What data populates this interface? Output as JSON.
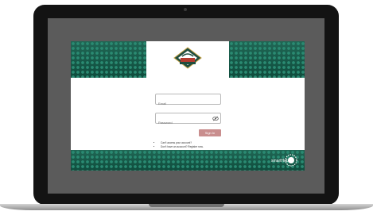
{
  "brand": {
    "logo_alt": "Sports Electric Cooperative",
    "smart_logo_text": "smartHub"
  },
  "form": {
    "email_placeholder": "Email",
    "password_placeholder": "Password",
    "signin_label": "Sign In"
  },
  "links": [
    "Can't access your account?",
    "Don't have an account? Register now."
  ],
  "colors": {
    "primary_green": "#125d4a",
    "signin_button": "#c98e8e",
    "screen_bezel": "#131313"
  },
  "icons": {
    "password_toggle": "eye-icon"
  }
}
